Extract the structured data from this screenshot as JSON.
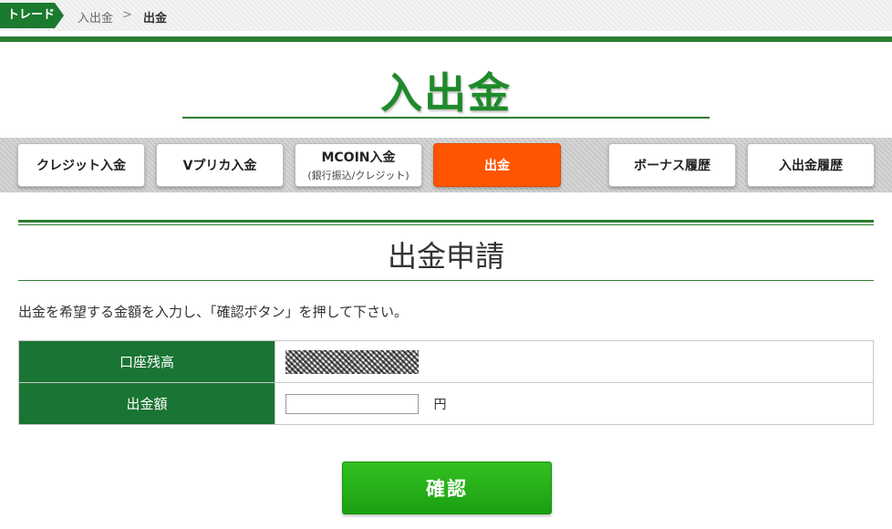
{
  "breadcrumb": {
    "home": "トレード",
    "link": "入出金",
    "separator": ">",
    "current": "出金"
  },
  "page_title": "入出金",
  "tabs": [
    {
      "label": "クレジット入金",
      "sub": ""
    },
    {
      "label": "Vプリカ入金",
      "sub": ""
    },
    {
      "label": "MCOIN入金",
      "sub": "(銀行振込/クレジット)"
    },
    {
      "label": "出金",
      "sub": "",
      "active": true
    },
    {
      "label": "ボーナス履歴",
      "sub": ""
    },
    {
      "label": "入出金履歴",
      "sub": ""
    }
  ],
  "section": {
    "title": "出金申請",
    "instruction": "出金を希望する金額を入力し、「確認ボタン」を押して下さい。"
  },
  "form": {
    "balance_label": "口座残高",
    "amount_label": "出金額",
    "amount_value": "",
    "amount_unit": "円"
  },
  "confirm_label": "確認",
  "colors": {
    "brand_green": "#1a7433",
    "active_tab": "#ff5500",
    "confirm_button": "#22b018"
  }
}
